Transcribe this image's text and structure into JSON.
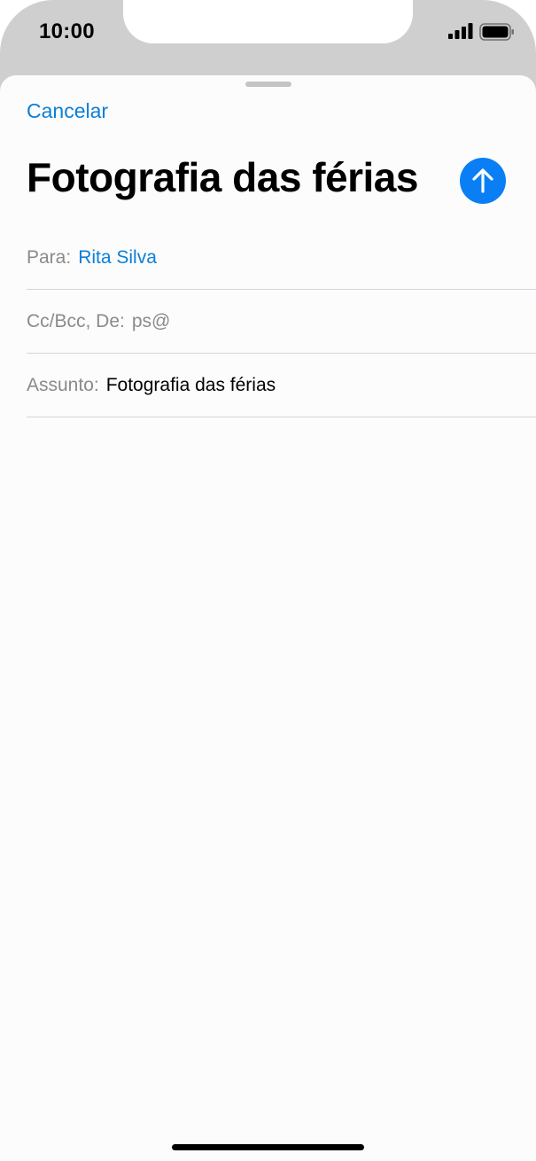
{
  "status_bar": {
    "time": "10:00",
    "icons": [
      "signal-icon",
      "battery-icon"
    ]
  },
  "compose": {
    "cancel_label": "Cancelar",
    "title": "Fotografia das férias",
    "send_icon": "arrow-up-icon",
    "accent_color": "#0a7ff5",
    "fields": {
      "to_label": "Para:",
      "to_value": "Rita Silva",
      "cc_label": "Cc/Bcc, De:",
      "cc_value": "ps@",
      "subject_label": "Assunto:",
      "subject_value": "Fotografia das férias"
    }
  }
}
